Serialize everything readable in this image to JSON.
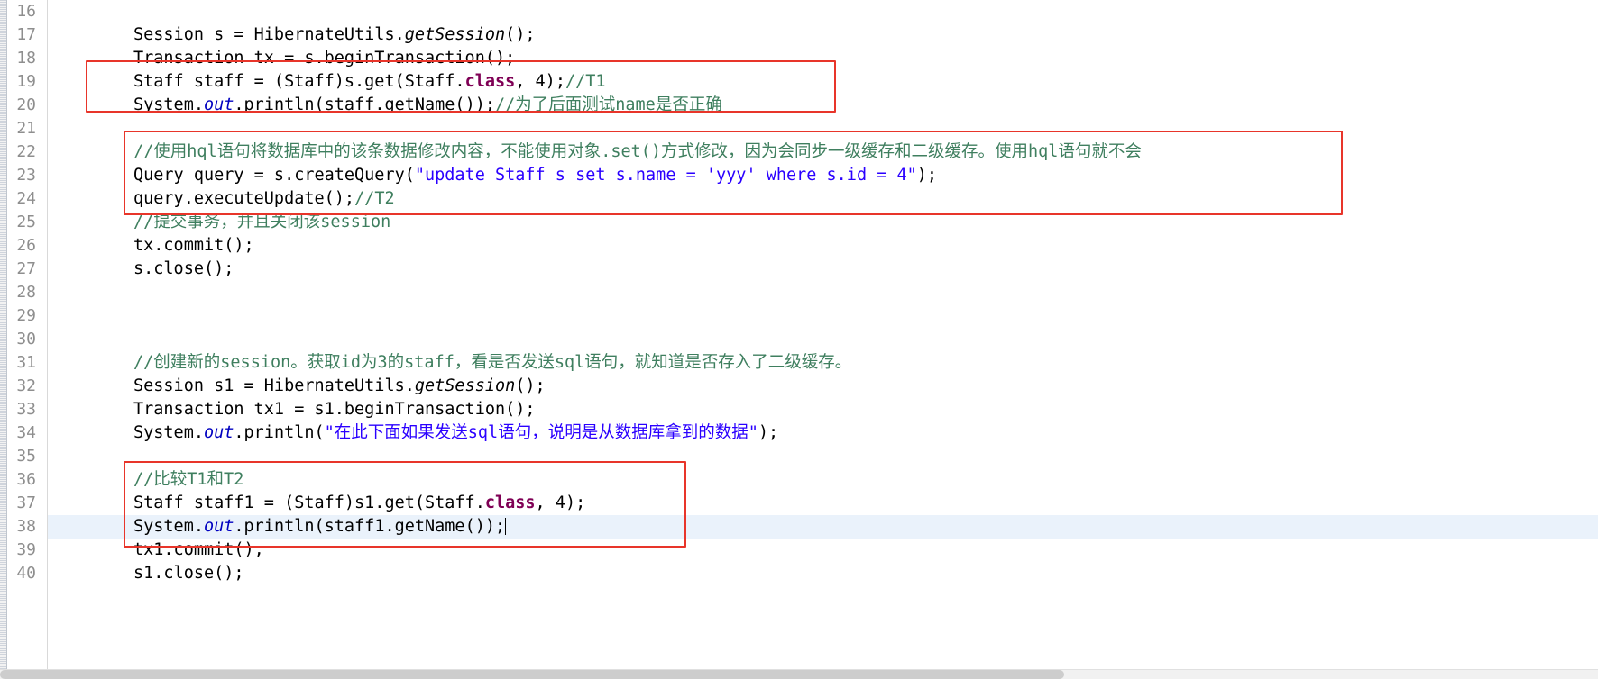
{
  "editor": {
    "title": "Java source editor",
    "current_line": 38,
    "caret_line": 38,
    "colors": {
      "keyword": "#7f0055",
      "string": "#2a00ff",
      "comment": "#3f7f5f",
      "field": "#0000c0",
      "annotation_box": "#e8352a",
      "current_line_bg": "#eaf2fb",
      "line_number": "#8e8e8e",
      "background": "#ffffff"
    },
    "line_numbers": [
      "16",
      "17",
      "18",
      "19",
      "20",
      "21",
      "22",
      "23",
      "24",
      "25",
      "26",
      "27",
      "28",
      "29",
      "30",
      "31",
      "32",
      "33",
      "34",
      "35",
      "36",
      "37",
      "38",
      "39",
      "40"
    ],
    "lines": [
      {
        "no": "16",
        "segments": []
      },
      {
        "no": "17",
        "segments": [
          {
            "t": "Session s = HibernateUtils.",
            "c": "plain"
          },
          {
            "t": "getSession",
            "c": "mth"
          },
          {
            "t": "();",
            "c": "plain"
          }
        ]
      },
      {
        "no": "18",
        "segments": [
          {
            "t": "Transaction tx = s.beginTransaction();",
            "c": "plain"
          }
        ]
      },
      {
        "no": "19",
        "segments": [
          {
            "t": "Staff staff = (Staff)s.get(Staff.",
            "c": "plain"
          },
          {
            "t": "class",
            "c": "kw"
          },
          {
            "t": ", 4);",
            "c": "plain"
          },
          {
            "t": "//T1",
            "c": "cmt"
          }
        ]
      },
      {
        "no": "20",
        "segments": [
          {
            "t": "System.",
            "c": "plain"
          },
          {
            "t": "out",
            "c": "fld"
          },
          {
            "t": ".println(staff.getName());",
            "c": "plain"
          },
          {
            "t": "//为了后面测试name是否正确",
            "c": "cmt"
          }
        ]
      },
      {
        "no": "21",
        "segments": []
      },
      {
        "no": "22",
        "segments": [
          {
            "t": "//使用hql语句将数据库中的该条数据修改内容，不能使用对象.set()方式修改，因为会同步一级缓存和二级缓存。使用hql语句就不会",
            "c": "cmt"
          }
        ]
      },
      {
        "no": "23",
        "segments": [
          {
            "t": "Query query = s.createQuery(",
            "c": "plain"
          },
          {
            "t": "\"update Staff s set s.name = 'yyy' where s.id = 4\"",
            "c": "str"
          },
          {
            "t": ");",
            "c": "plain"
          }
        ]
      },
      {
        "no": "24",
        "segments": [
          {
            "t": "query.executeUpdate();",
            "c": "plain"
          },
          {
            "t": "//T2",
            "c": "cmt"
          }
        ]
      },
      {
        "no": "25",
        "segments": [
          {
            "t": "//提交事务，并且关闭该session",
            "c": "cmt"
          }
        ]
      },
      {
        "no": "26",
        "segments": [
          {
            "t": "tx.commit();",
            "c": "plain"
          }
        ]
      },
      {
        "no": "27",
        "segments": [
          {
            "t": "s.close();",
            "c": "plain"
          }
        ]
      },
      {
        "no": "28",
        "segments": []
      },
      {
        "no": "29",
        "segments": []
      },
      {
        "no": "30",
        "segments": []
      },
      {
        "no": "31",
        "segments": [
          {
            "t": "//创建新的session。获取id为3的staff，看是否发送sql语句，就知道是否存入了二级缓存。",
            "c": "cmt"
          }
        ]
      },
      {
        "no": "32",
        "segments": [
          {
            "t": "Session s1 = HibernateUtils.",
            "c": "plain"
          },
          {
            "t": "getSession",
            "c": "mth"
          },
          {
            "t": "();",
            "c": "plain"
          }
        ]
      },
      {
        "no": "33",
        "segments": [
          {
            "t": "Transaction tx1 = s1.beginTransaction();",
            "c": "plain"
          }
        ]
      },
      {
        "no": "34",
        "segments": [
          {
            "t": "System.",
            "c": "plain"
          },
          {
            "t": "out",
            "c": "fld"
          },
          {
            "t": ".println(",
            "c": "plain"
          },
          {
            "t": "\"在此下面如果发送sql语句，说明是从数据库拿到的数据\"",
            "c": "str"
          },
          {
            "t": ");",
            "c": "plain"
          }
        ]
      },
      {
        "no": "35",
        "segments": []
      },
      {
        "no": "36",
        "segments": [
          {
            "t": "//比较T1和T2",
            "c": "cmt"
          }
        ]
      },
      {
        "no": "37",
        "segments": [
          {
            "t": "Staff staff1 = (Staff)s1.get(Staff.",
            "c": "plain"
          },
          {
            "t": "class",
            "c": "kw"
          },
          {
            "t": ", 4);",
            "c": "plain"
          }
        ]
      },
      {
        "no": "38",
        "segments": [
          {
            "t": "System.",
            "c": "plain"
          },
          {
            "t": "out",
            "c": "fld"
          },
          {
            "t": ".println(staff1.getName());",
            "c": "plain"
          }
        ]
      },
      {
        "no": "39",
        "segments": [
          {
            "t": "tx1.commit();",
            "c": "plain"
          }
        ]
      },
      {
        "no": "40",
        "segments": [
          {
            "t": "s1.close();",
            "c": "plain"
          }
        ]
      }
    ],
    "annotations": [
      {
        "id": "redbox-1",
        "label": "highlight-box-t1-read",
        "lines": "19-20"
      },
      {
        "id": "redbox-2",
        "label": "highlight-box-hql-update",
        "lines": "22-24"
      },
      {
        "id": "redbox-3",
        "label": "highlight-box-t1-t2-compare",
        "lines": "36-38"
      }
    ]
  }
}
